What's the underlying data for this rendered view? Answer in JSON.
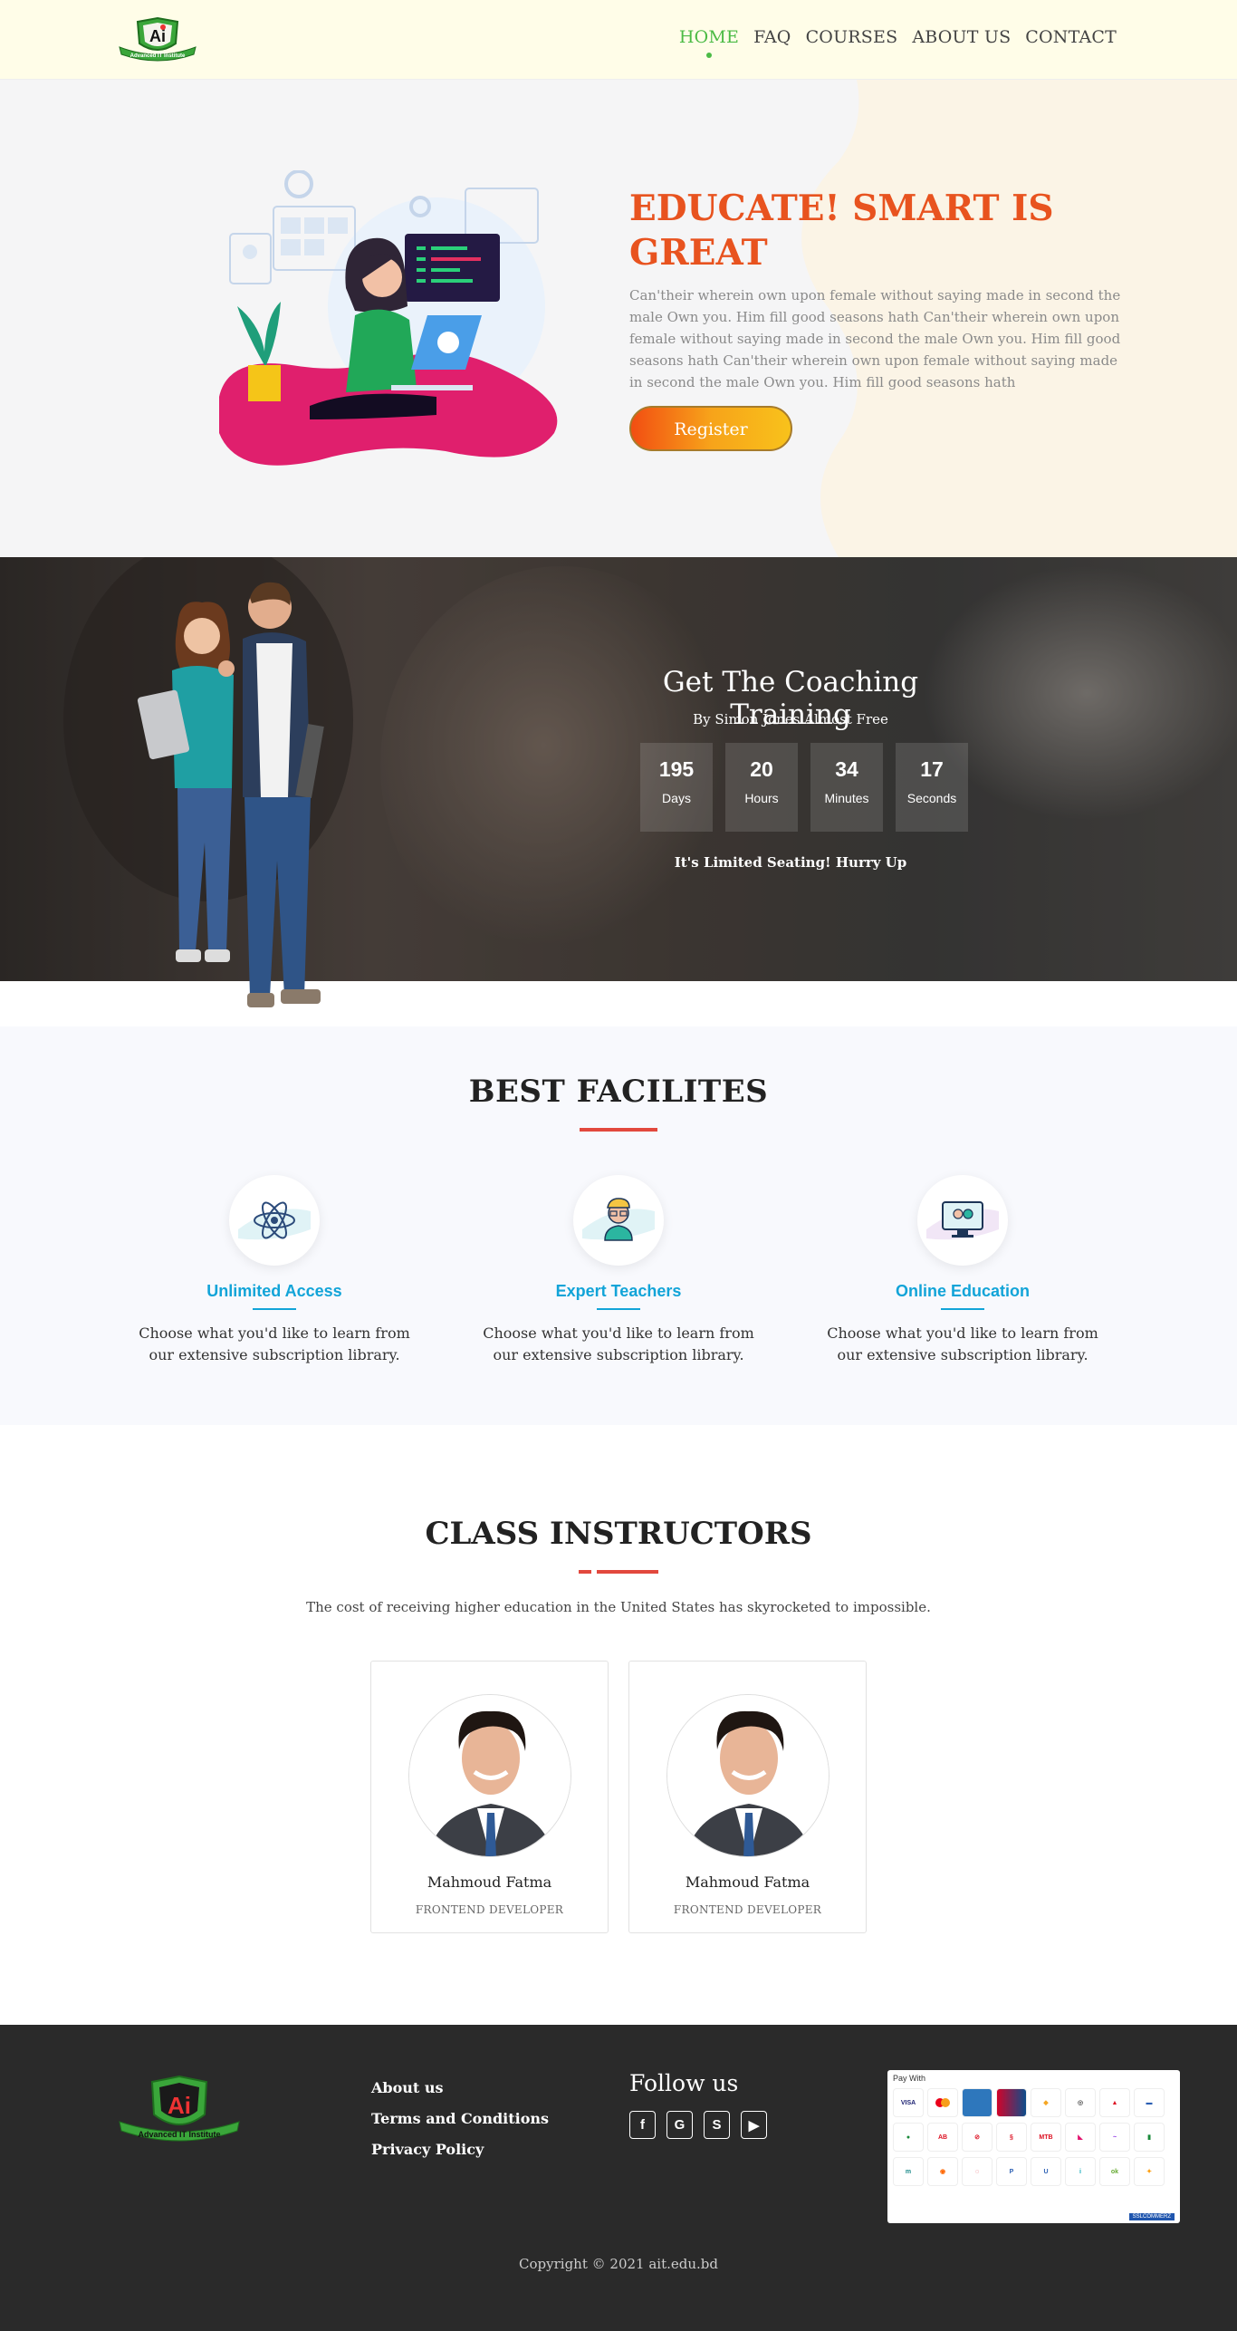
{
  "header": {
    "logo_text": "Advanced IT Institute",
    "nav": [
      "HOME",
      "FAQ",
      "COURSES",
      "ABOUT US",
      "CONTACT"
    ]
  },
  "hero": {
    "title": "EDUCATE! SMART IS GREAT",
    "description": "Can'their wherein own upon female without saying made in second the male Own you. Him fill good seasons hath Can'their wherein own upon female without saying made in second the male Own you. Him fill good seasons hath Can'their wherein own upon female without saying made in second the male Own you. Him fill good seasons hath",
    "button": "Register"
  },
  "coaching": {
    "title": "Get The Coaching Training",
    "subtitle": "By Simon Jones Almost Free",
    "countdown": [
      {
        "value": "195",
        "label": "Days"
      },
      {
        "value": "20",
        "label": "Hours"
      },
      {
        "value": "34",
        "label": "Minutes"
      },
      {
        "value": "17",
        "label": "Seconds"
      }
    ],
    "hurry": "It's Limited Seating! Hurry Up"
  },
  "facilities": {
    "title": "BEST FACILITES",
    "items": [
      {
        "name": "Unlimited Access",
        "desc": "Choose what you'd like to learn from our extensive subscription library.",
        "icon": "atom-icon"
      },
      {
        "name": "Expert Teachers",
        "desc": "Choose what you'd like to learn from our extensive subscription library.",
        "icon": "teacher-icon"
      },
      {
        "name": "Online Education",
        "desc": "Choose what you'd like to learn from our extensive subscription library.",
        "icon": "monitor-icon"
      }
    ]
  },
  "instructors": {
    "title": "CLASS INSTRUCTORS",
    "subtitle": "The cost of receiving higher education in the United States has skyrocketed to impossible.",
    "items": [
      {
        "name": "Mahmoud Fatma",
        "role": "FRONTEND DEVELOPER"
      },
      {
        "name": "Mahmoud Fatma",
        "role": "FRONTEND DEVELOPER"
      }
    ]
  },
  "footer": {
    "links": [
      "About us",
      "Terms and Conditions",
      "Privacy Policy"
    ],
    "follow_title": "Follow us",
    "social": [
      {
        "icon": "facebook-icon",
        "glyph": "f"
      },
      {
        "icon": "google-icon",
        "glyph": "G"
      },
      {
        "icon": "skype-icon",
        "glyph": "S"
      },
      {
        "icon": "youtube-icon",
        "glyph": "▶"
      }
    ],
    "pay_with": "Pay With",
    "copyright": "Copyright © 2021 ait.edu.bd"
  },
  "colors": {
    "accent_green": "#4cbb45",
    "hero_orange": "#e8531f",
    "facility_blue": "#12a4d8",
    "bar_red": "#e2483d",
    "footer_bg": "#2a2a2a"
  }
}
